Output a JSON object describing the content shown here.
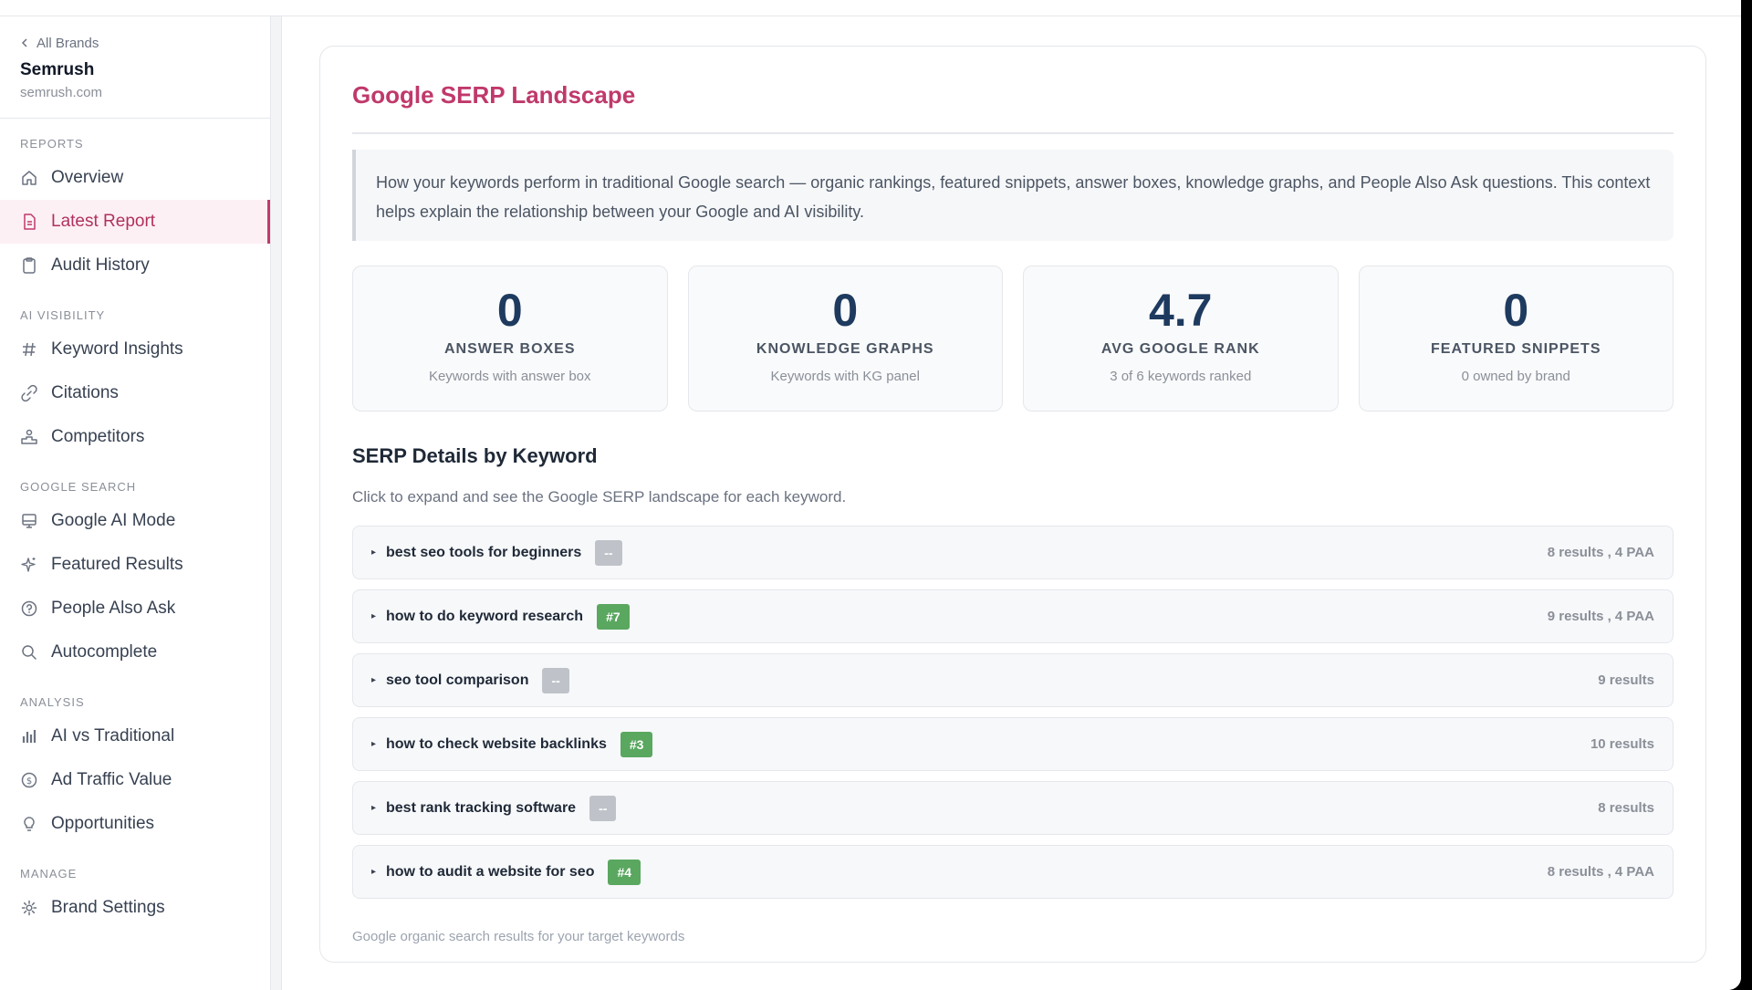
{
  "sidebar": {
    "back_label": "All Brands",
    "brand_name": "Semrush",
    "brand_domain": "semrush.com",
    "sections": {
      "reports": "REPORTS",
      "ai_visibility": "AI VISIBILITY",
      "google_search": "GOOGLE SEARCH",
      "analysis": "ANALYSIS",
      "manage": "MANAGE"
    },
    "items": {
      "overview": "Overview",
      "latest_report": "Latest Report",
      "audit_history": "Audit History",
      "keyword_insights": "Keyword Insights",
      "citations": "Citations",
      "competitors": "Competitors",
      "google_ai_mode": "Google AI Mode",
      "featured_results": "Featured Results",
      "people_also_ask": "People Also Ask",
      "autocomplete": "Autocomplete",
      "ai_vs_traditional": "AI vs Traditional",
      "ad_traffic_value": "Ad Traffic Value",
      "opportunities": "Opportunities",
      "brand_settings": "Brand Settings"
    },
    "active_item": "latest_report"
  },
  "main": {
    "title": "Google SERP Landscape",
    "intro": "How your keywords perform in traditional Google search — organic rankings, featured snippets, answer boxes, knowledge graphs, and People Also Ask questions. This context helps explain the relationship between your Google and AI visibility.",
    "stats": [
      {
        "value": "0",
        "label": "ANSWER BOXES",
        "sub": "Keywords with answer box"
      },
      {
        "value": "0",
        "label": "KNOWLEDGE GRAPHS",
        "sub": "Keywords with KG panel"
      },
      {
        "value": "4.7",
        "label": "AVG GOOGLE RANK",
        "sub": "3 of 6 keywords ranked"
      },
      {
        "value": "0",
        "label": "FEATURED SNIPPETS",
        "sub": "0 owned by brand"
      }
    ],
    "section_title": "SERP Details by Keyword",
    "section_subtitle": "Click to expand and see the Google SERP landscape for each keyword.",
    "keywords": [
      {
        "caret": "▸",
        "text": "best seo tools for beginners",
        "badge": "--",
        "ranked": false,
        "meta": "8 results , 4 PAA"
      },
      {
        "caret": "▸",
        "text": "how to do keyword research",
        "badge": "#7",
        "ranked": true,
        "meta": "9 results , 4 PAA"
      },
      {
        "caret": "▸",
        "text": "seo tool comparison",
        "badge": "--",
        "ranked": false,
        "meta": "9 results"
      },
      {
        "caret": "▸",
        "text": "how to check website backlinks",
        "badge": "#3",
        "ranked": true,
        "meta": "10 results"
      },
      {
        "caret": "▸",
        "text": "best rank tracking software",
        "badge": "--",
        "ranked": false,
        "meta": "8 results"
      },
      {
        "caret": "▸",
        "text": "how to audit a website for seo",
        "badge": "#4",
        "ranked": true,
        "meta": "8 results , 4 PAA"
      }
    ],
    "footnote": "Google organic search results for your target keywords"
  },
  "colors": {
    "accent": "#c0396b",
    "stat_value": "#1e3a5f",
    "rank_badge": "#5aa760",
    "none_badge": "#bfc3c9"
  }
}
